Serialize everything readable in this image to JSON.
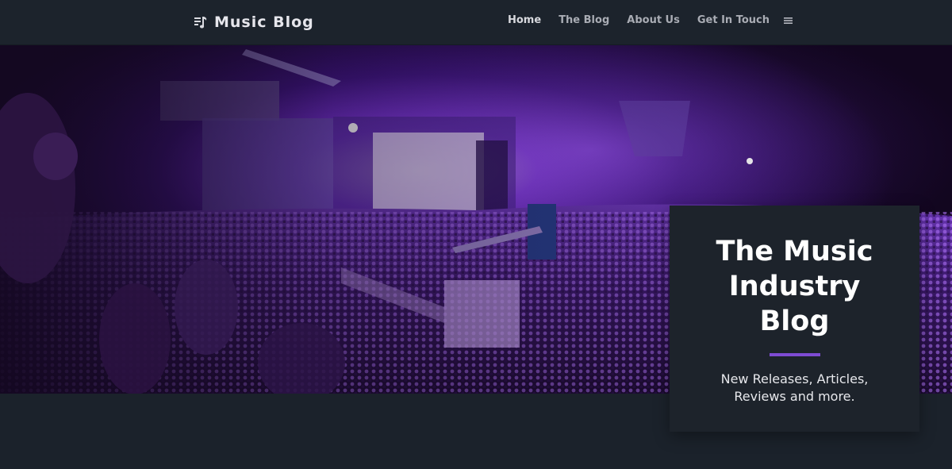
{
  "header": {
    "brand": "Music Blog",
    "brand_icon": "music-note-icon",
    "nav": [
      {
        "label": "Home",
        "active": true
      },
      {
        "label": "The Blog",
        "active": false
      },
      {
        "label": "About Us",
        "active": false
      },
      {
        "label": "Get In Touch",
        "active": false
      }
    ],
    "menu_icon": "hamburger-menu-icon"
  },
  "hero": {
    "image": "concert-crowd-purple-stage-lights"
  },
  "card": {
    "title": "The Music Industry Blog",
    "subtitle": "New Releases, Articles, Reviews and more."
  },
  "colors": {
    "background": "#1b222b",
    "accent": "#7e4bd3",
    "stage_purple": "#8a3cf0"
  }
}
